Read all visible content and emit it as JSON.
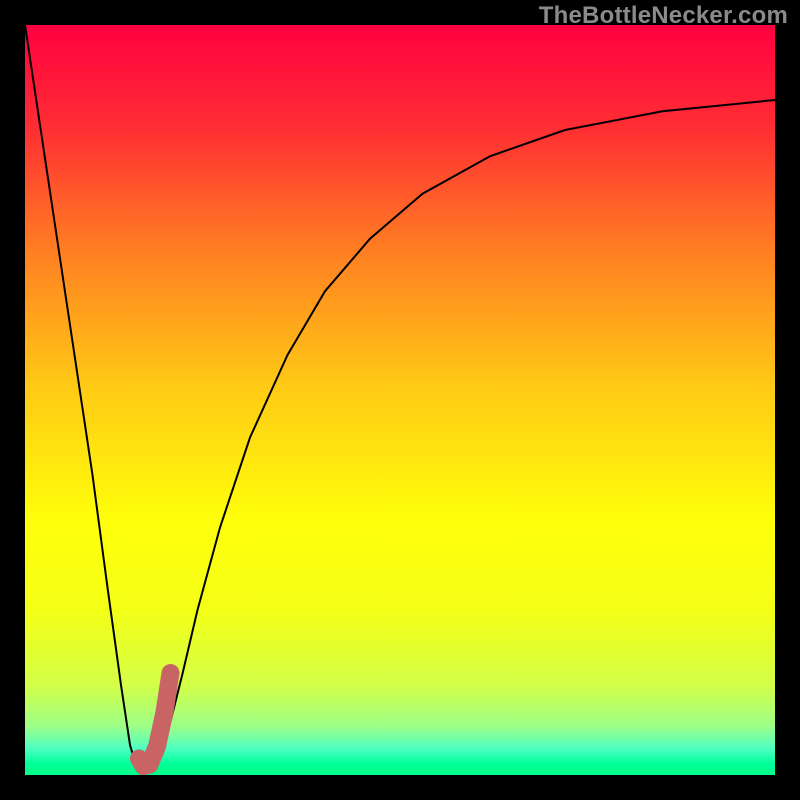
{
  "watermark": "TheBottleNecker.com",
  "chart_data": {
    "type": "line",
    "title": "",
    "xlabel": "",
    "ylabel": "",
    "xlim": [
      0,
      100
    ],
    "ylim": [
      0,
      100
    ],
    "grid": false,
    "background": {
      "orientation": "vertical",
      "stops": [
        {
          "pos": 0.0,
          "color": "#ff0040"
        },
        {
          "pos": 0.14,
          "color": "#ff2f33"
        },
        {
          "pos": 0.3,
          "color": "#ff7e22"
        },
        {
          "pos": 0.48,
          "color": "#ffc915"
        },
        {
          "pos": 0.66,
          "color": "#ffff0a"
        },
        {
          "pos": 0.78,
          "color": "#f4ff16"
        },
        {
          "pos": 0.88,
          "color": "#d3ff47"
        },
        {
          "pos": 0.935,
          "color": "#9dff88"
        },
        {
          "pos": 0.965,
          "color": "#4dffc2"
        },
        {
          "pos": 0.985,
          "color": "#00ff99"
        },
        {
          "pos": 1.0,
          "color": "#00ff88"
        }
      ]
    },
    "series": [
      {
        "name": "bottleneck-curve",
        "color": "#000000",
        "width": 2,
        "points": [
          [
            0,
            100
          ],
          [
            3,
            80
          ],
          [
            6,
            60
          ],
          [
            9,
            40
          ],
          [
            11,
            25
          ],
          [
            12.8,
            12
          ],
          [
            14,
            4
          ],
          [
            15,
            0.6
          ],
          [
            15.6,
            0.2
          ],
          [
            16.2,
            0.4
          ],
          [
            17,
            1.2
          ],
          [
            18,
            3
          ],
          [
            19.5,
            7.5
          ],
          [
            21,
            13.5
          ],
          [
            23,
            22
          ],
          [
            26,
            33
          ],
          [
            30,
            45
          ],
          [
            35,
            56
          ],
          [
            40,
            64.5
          ],
          [
            46,
            71.5
          ],
          [
            53,
            77.5
          ],
          [
            62,
            82.5
          ],
          [
            72,
            86
          ],
          [
            85,
            88.5
          ],
          [
            100,
            90
          ]
        ]
      },
      {
        "name": "highlight-hook",
        "color": "#c86464",
        "width": 18,
        "linecap": "round",
        "points": [
          [
            15.2,
            2.2
          ],
          [
            15.8,
            1.2
          ],
          [
            16.6,
            1.4
          ],
          [
            17.6,
            3.8
          ],
          [
            18.6,
            8.4
          ],
          [
            19.4,
            13.6
          ]
        ]
      }
    ]
  }
}
